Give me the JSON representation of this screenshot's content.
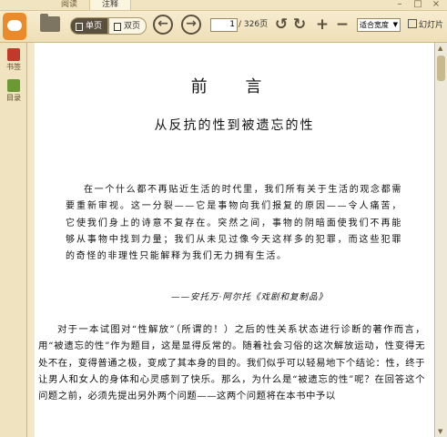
{
  "tabs": [
    "阅读",
    "注释"
  ],
  "toolbar": {
    "single_page": "单页",
    "double_page": "双页",
    "current_page": "1",
    "total_pages": "/ 326页",
    "zoom": "适合宽度",
    "slideshow": "幻灯片"
  },
  "sidebar": {
    "items": [
      {
        "label": "书签",
        "icon": "bookmark-icon",
        "color": "#c0392b"
      },
      {
        "label": "目录",
        "icon": "toc-icon",
        "color": "#6b9a34"
      }
    ]
  },
  "document": {
    "title": "前 言",
    "subtitle": "从反抗的性到被遗忘的性",
    "epigraph": "在一个什么都不再贴近生活的时代里，我们所有关于生活的观念都需要重新审视。这一分裂——它是事物向我们报复的原因——令人痛苦，它使我们身上的诗意不复存在。突然之间，事物的阴暗面使我们不再能够从事物中找到力量；我们从未见过像今天这样多的犯罪，而这些犯罪的奇怪的非理性只能解释为我们无力拥有生活。",
    "attribution": "——安托万·阿尔托《戏剧和复制品》",
    "body": "对于一本试图对“性解放”（所谓的！）之后的性关系状态进行诊断的著作而言，用“被遗忘的性”作为题目，这是显得反常的。随着社会习俗的这次解放运动，性变得无处不在，变得普通之极，变成了其本身的目的。我们似乎可以轻易地下个结论：性，终于让男人和女人的身体和心灵感到了快乐。那么，为什么是“被遗忘的性”呢？在回答这个问题之前，必须先提出另外两个问题——这两个问题将在本书中予以"
  },
  "colors": {
    "toolbar_bg": "#f3e7c6",
    "logo": "#e98a2c",
    "icon_dark": "#5a5040"
  }
}
